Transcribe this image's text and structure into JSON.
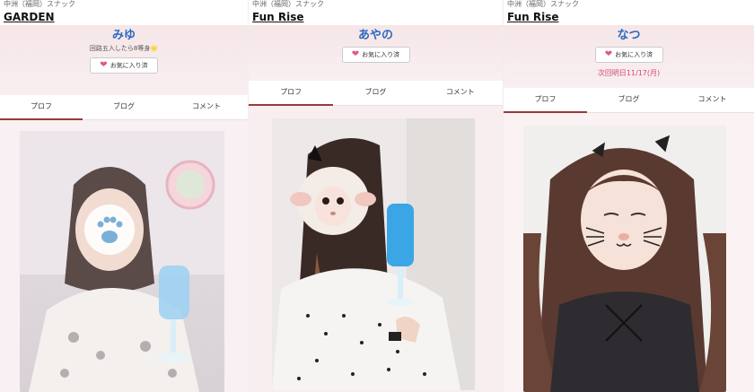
{
  "panels": [
    {
      "area": "中洲（福岡）スナック",
      "shop": "GARDEN",
      "name": "みゆ",
      "catch": "回路五入したら8等身🌟",
      "fav_label": "お気に入り済",
      "next": "",
      "tabs": [
        "プロフ",
        "ブログ",
        "コメント"
      ]
    },
    {
      "area": "中洲（福岡）スナック",
      "shop": "Fun Rise",
      "name": "あやの",
      "catch": "",
      "fav_label": "お気に入り済",
      "next": "",
      "tabs": [
        "プロフ",
        "ブログ",
        "コメント"
      ]
    },
    {
      "area": "中洲（福岡）スナック",
      "shop": "Fun Rise",
      "name": "なつ",
      "catch": "",
      "fav_label": "お気に入り済",
      "next": "次回明日11/17(月)",
      "tabs": [
        "プロフ",
        "ブログ",
        "コメント"
      ]
    }
  ],
  "icons": {
    "heart": "heart-icon",
    "paw": "paw-sticker-icon",
    "sheep": "sheep-sticker-icon",
    "cat": "cat-filter-icon"
  },
  "colors": {
    "name": "#2a6ac0",
    "heart": "#e05a7e",
    "accent": "#9a3a3a",
    "next": "#d24a70"
  }
}
